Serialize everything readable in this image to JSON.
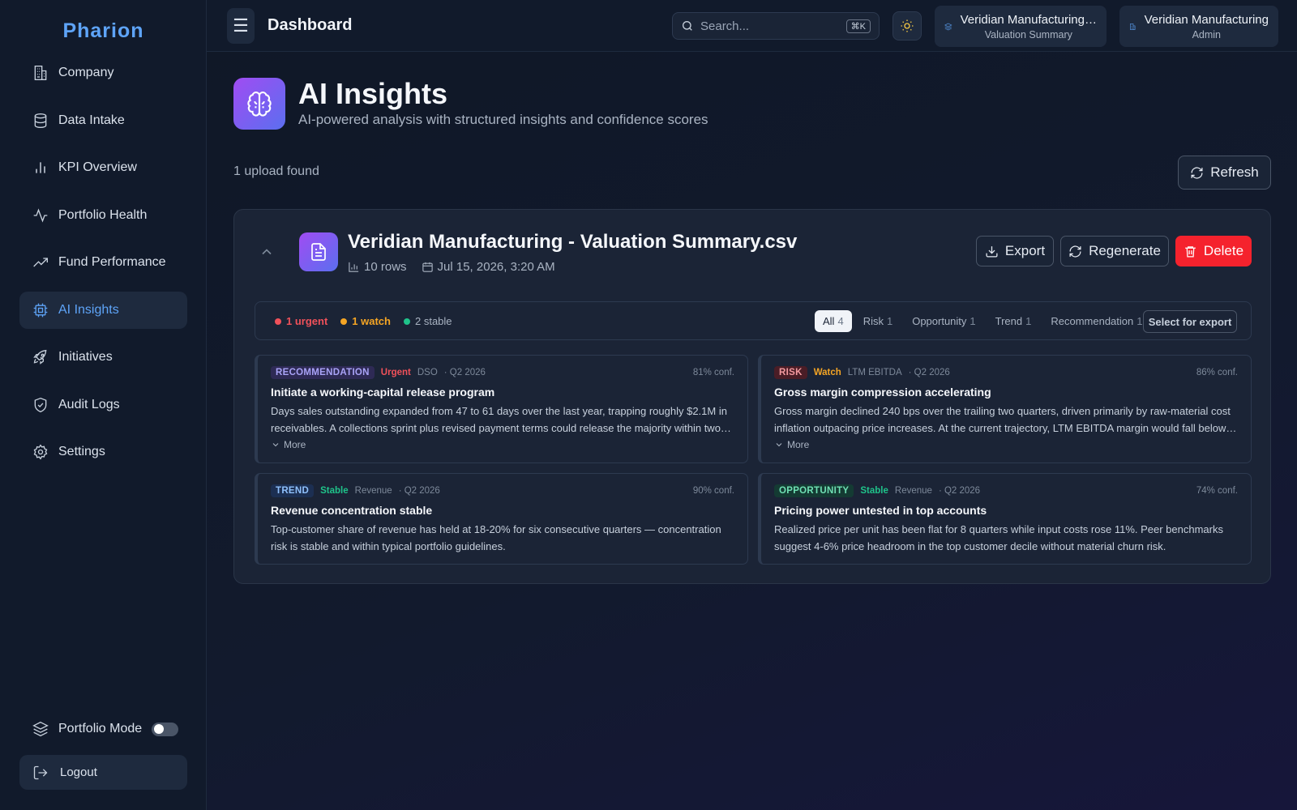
{
  "brand": "Pharion",
  "sidebar": {
    "items": [
      {
        "label": "Company",
        "icon": "building-icon"
      },
      {
        "label": "Data Intake",
        "icon": "database-icon"
      },
      {
        "label": "KPI Overview",
        "icon": "bar-chart-icon"
      },
      {
        "label": "Portfolio Health",
        "icon": "activity-icon"
      },
      {
        "label": "Fund Performance",
        "icon": "trending-up-icon"
      },
      {
        "label": "AI Insights",
        "icon": "cpu-icon",
        "active": true
      },
      {
        "label": "Initiatives",
        "icon": "rocket-icon"
      },
      {
        "label": "Audit Logs",
        "icon": "shield-check-icon"
      },
      {
        "label": "Settings",
        "icon": "gear-icon"
      }
    ],
    "portfolio_mode_label": "Portfolio Mode",
    "portfolio_mode_on": false,
    "logout_label": "Logout"
  },
  "header": {
    "menu_glyph": "☰",
    "title": "Dashboard",
    "search_placeholder": "Search...",
    "search_shortcut": "⌘K",
    "context_dataset": {
      "title": "Veridian Manufacturing…",
      "subtitle": "Valuation Summary"
    },
    "context_company": {
      "title": "Veridian Manufacturing",
      "subtitle": "Admin"
    }
  },
  "page": {
    "title": "AI Insights",
    "subtitle": "AI-powered analysis with structured insights and confidence scores",
    "upload_count": "1 upload found",
    "refresh_label": "Refresh"
  },
  "upload": {
    "file_name": "Veridian Manufacturing - Valuation Summary.csv",
    "rows": "10 rows",
    "date": "Jul 15, 2026, 3:20 AM",
    "export_label": "Export",
    "regenerate_label": "Regenerate",
    "delete_label": "Delete",
    "counts": {
      "urgent": "1 urgent",
      "watch": "1 watch",
      "stable": "2 stable"
    },
    "tabs": [
      {
        "label": "All",
        "count": "4",
        "active": true
      },
      {
        "label": "Risk",
        "count": "1"
      },
      {
        "label": "Opportunity",
        "count": "1"
      },
      {
        "label": "Trend",
        "count": "1"
      },
      {
        "label": "Recommendation",
        "count": "1"
      }
    ],
    "select_for_export_label": "Select for export",
    "more_label": "More",
    "insights": [
      {
        "type": "RECOMMENDATION",
        "severity": "Urgent",
        "metric": "DSO",
        "period": "· Q2 2026",
        "confidence": "81% conf.",
        "title": "Initiate a working-capital release program",
        "body": "Days sales outstanding expanded from 47 to 61 days over the last year, trapping roughly $2.1M in receivables. A collections sprint plus revised payment terms could release the majority within two…"
      },
      {
        "type": "RISK",
        "severity": "Watch",
        "metric": "LTM EBITDA",
        "period": "· Q2 2026",
        "confidence": "86% conf.",
        "title": "Gross margin compression accelerating",
        "body": "Gross margin declined 240 bps over the trailing two quarters, driven primarily by raw-material cost inflation outpacing price increases. At the current trajectory, LTM EBITDA margin would fall below the…"
      },
      {
        "type": "TREND",
        "severity": "Stable",
        "metric": "Revenue",
        "period": "· Q2 2026",
        "confidence": "90% conf.",
        "title": "Revenue concentration stable",
        "body": "Top-customer share of revenue has held at 18-20% for six consecutive quarters — concentration risk is stable and within typical portfolio guidelines."
      },
      {
        "type": "OPPORTUNITY",
        "severity": "Stable",
        "metric": "Revenue",
        "period": "· Q2 2026",
        "confidence": "74% conf.",
        "title": "Pricing power untested in top accounts",
        "body": "Realized price per unit has been flat for 8 quarters while input costs rose 11%. Peer benchmarks suggest 4-6% price headroom in the top customer decile without material churn risk."
      }
    ]
  },
  "colors": {
    "accent": "#5ea4f8",
    "urgent": "#f0515a",
    "watch": "#f5a524",
    "stable": "#1fc38a",
    "delete": "#f5222d"
  }
}
